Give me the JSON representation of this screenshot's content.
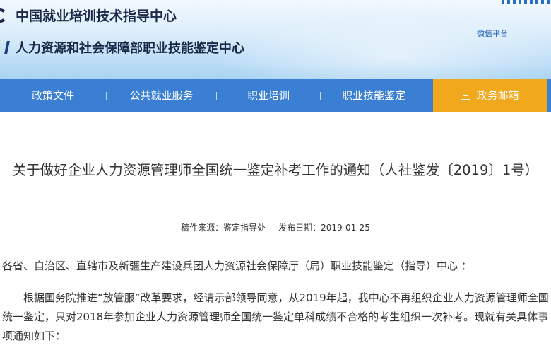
{
  "header": {
    "org_name_1": "中国就业培训技术指导中心",
    "org_name_2": "人力资源和社会保障部职业技能鉴定中心",
    "wechat_link": "微信平台"
  },
  "nav": {
    "items": [
      {
        "label": "政策文件"
      },
      {
        "label": "公共就业服务"
      },
      {
        "label": "职业培训"
      },
      {
        "label": "职业技能鉴定"
      }
    ],
    "mailbox_label": "政务邮箱"
  },
  "article": {
    "title": "关于做好企业人力资源管理师全国统一鉴定补考工作的通知（人社鉴发〔2019〕1号）",
    "source_label": "稿件来源：鉴定指导处",
    "date_label": "发布日期：2019-01-25",
    "salutation": "各省、自治区、直辖市及新疆生产建设兵团人力资源社会保障厅（局）职业技能鉴定（指导）中心 ：",
    "body": "根据国务院推进“放管服”改革要求，经请示部领导同意，从2019年起，我中心不再组织企业人力资源管理师全国统一鉴定，只对2018年参加企业人力资源管理师全国统一鉴定单科成绩不合格的考生组织一次补考。现就有关具体事项通知如下："
  },
  "colors": {
    "nav_bg": "#3a7fd4",
    "mailbox_bg": "#f0a81c",
    "header_title": "#1b2a4a",
    "link": "#1d5fb3"
  }
}
